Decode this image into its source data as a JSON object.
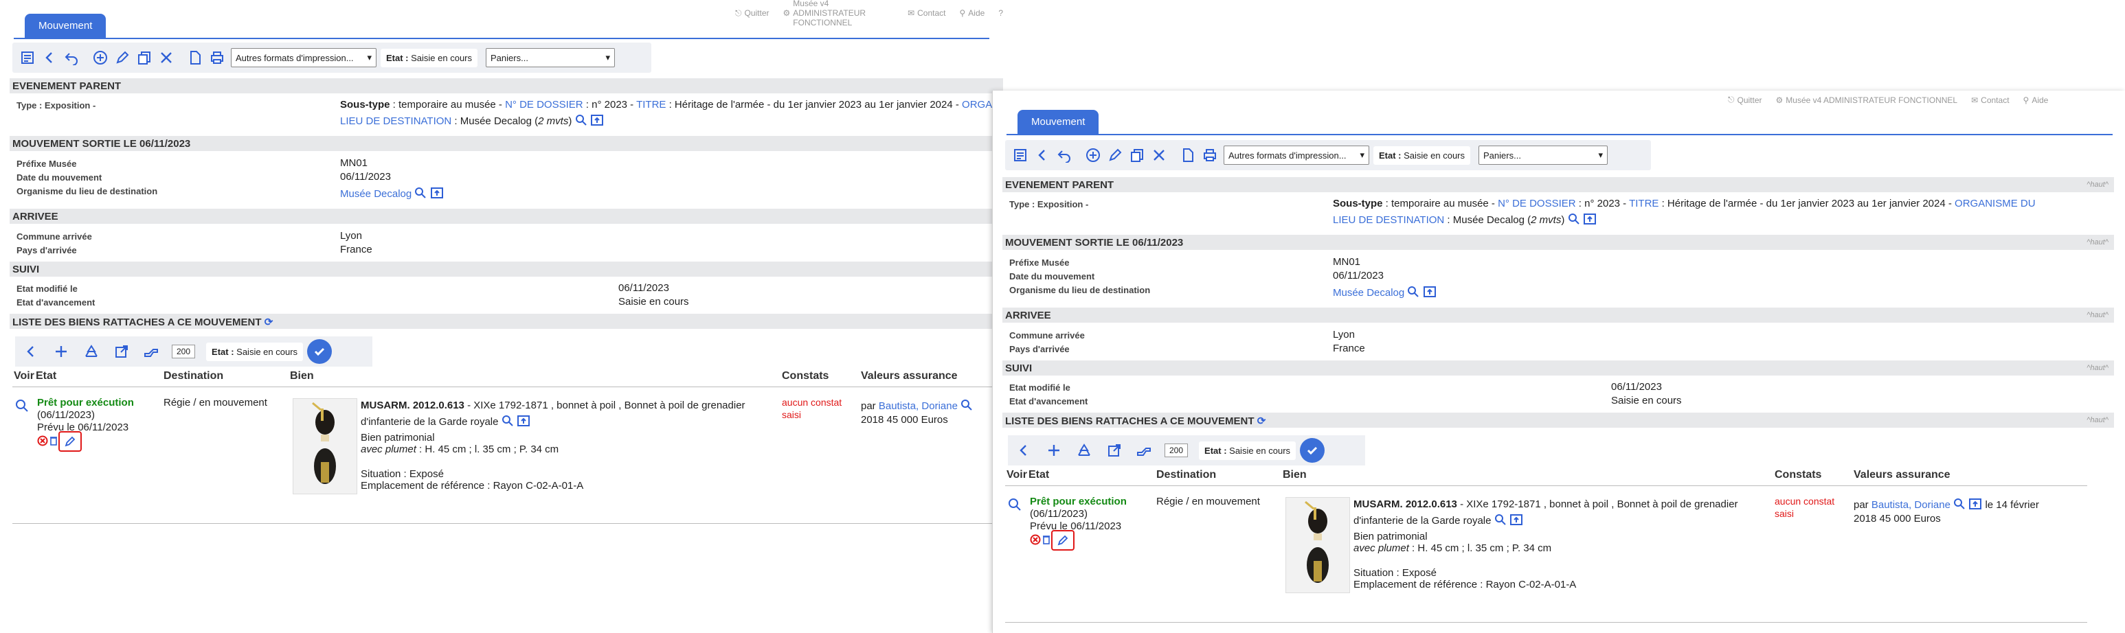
{
  "topnav": {
    "quit": "Quitter",
    "user": "Musée v4 ADMINISTRATEUR FONCTIONNEL",
    "contact": "Contact",
    "help": "Aide",
    "extra": "?"
  },
  "tab": {
    "label": "Mouvement"
  },
  "toolbar": {
    "print_formats": "Autres formats d'impression...",
    "etat_label": "Etat :",
    "etat_value": "Saisie en cours",
    "paniers": "Paniers..."
  },
  "parent": {
    "title": "EVENEMENT PARENT",
    "haut": "^haut^",
    "type_label": "Type : Exposition -",
    "soustype_label": "Sous-type",
    "soustype_value": " : temporaire au musée -",
    "dossier_label": "N° DE DOSSIER",
    "dossier_value": " : n° 2023 -",
    "titre_label": "TITRE",
    "titre_value": " : Héritage de l'armée - du 1er janvier 2023 au 1er janvier 2024 -",
    "org_label": "ORGANISME DU",
    "lieu_label": "LIEU DE DESTINATION",
    "lieu_value": " : Musée Decalog (",
    "lieu_count": "2 mvts",
    "lieu_end": ")"
  },
  "sortie": {
    "title": "MOUVEMENT SORTIE LE 06/11/2023",
    "haut": "^haut^",
    "prefixe_label": "Préfixe Musée",
    "prefixe_value": "MN01",
    "date_label": "Date du mouvement",
    "date_value": "06/11/2023",
    "org_label": "Organisme du lieu de destination",
    "org_value": "Musée Decalog"
  },
  "arrivee": {
    "title": "ARRIVEE",
    "haut": "^haut^",
    "commune_label": "Commune arrivée",
    "commune_value": "Lyon",
    "pays_label": "Pays d'arrivée",
    "pays_value": "France"
  },
  "suivi": {
    "title": "SUIVI",
    "haut": "^haut^",
    "etat_mod_label": "Etat modifié le",
    "etat_mod_value": "06/11/2023",
    "avanc_label": "Etat d'avancement",
    "avanc_value": "Saisie en cours"
  },
  "biens": {
    "title": "LISTE DES BIENS RATTACHES A CE MOUVEMENT",
    "haut": "^haut^",
    "count": "200",
    "etat_label": "Etat :",
    "etat_value": "Saisie en cours",
    "headers": {
      "voir": "Voir",
      "etat": "Etat",
      "destination": "Destination",
      "bien": "Bien",
      "constats": "Constats",
      "valeurs": "Valeurs assurance"
    },
    "row": {
      "status": "Prêt pour exécution",
      "status_date": "(06/11/2023)",
      "prevu": "Prévu le 06/11/2023",
      "destination": "Régie / en mouvement",
      "inv": "MUSARM. 2012.0.613",
      "desc1": " - XIXe 1792-1871 , bonnet à poil , Bonnet à poil de grenadier",
      "desc2": "d'infanterie de la Garde royale",
      "type": "Bien patrimonial",
      "dims_label": "avec plumet",
      "dims": " : H. 45 cm ;  l. 35 cm ;  P. 34 cm",
      "situation": "Situation : Exposé",
      "emplacement": "Emplacement de référence : Rayon C-02-A-01-A",
      "constat1": "aucun constat",
      "constat2": "saisi",
      "par": "par ",
      "assure": "Bautista, Doriane",
      "date_assur": "le 14 février",
      "valeur": "2018 45 000 Euros"
    }
  }
}
